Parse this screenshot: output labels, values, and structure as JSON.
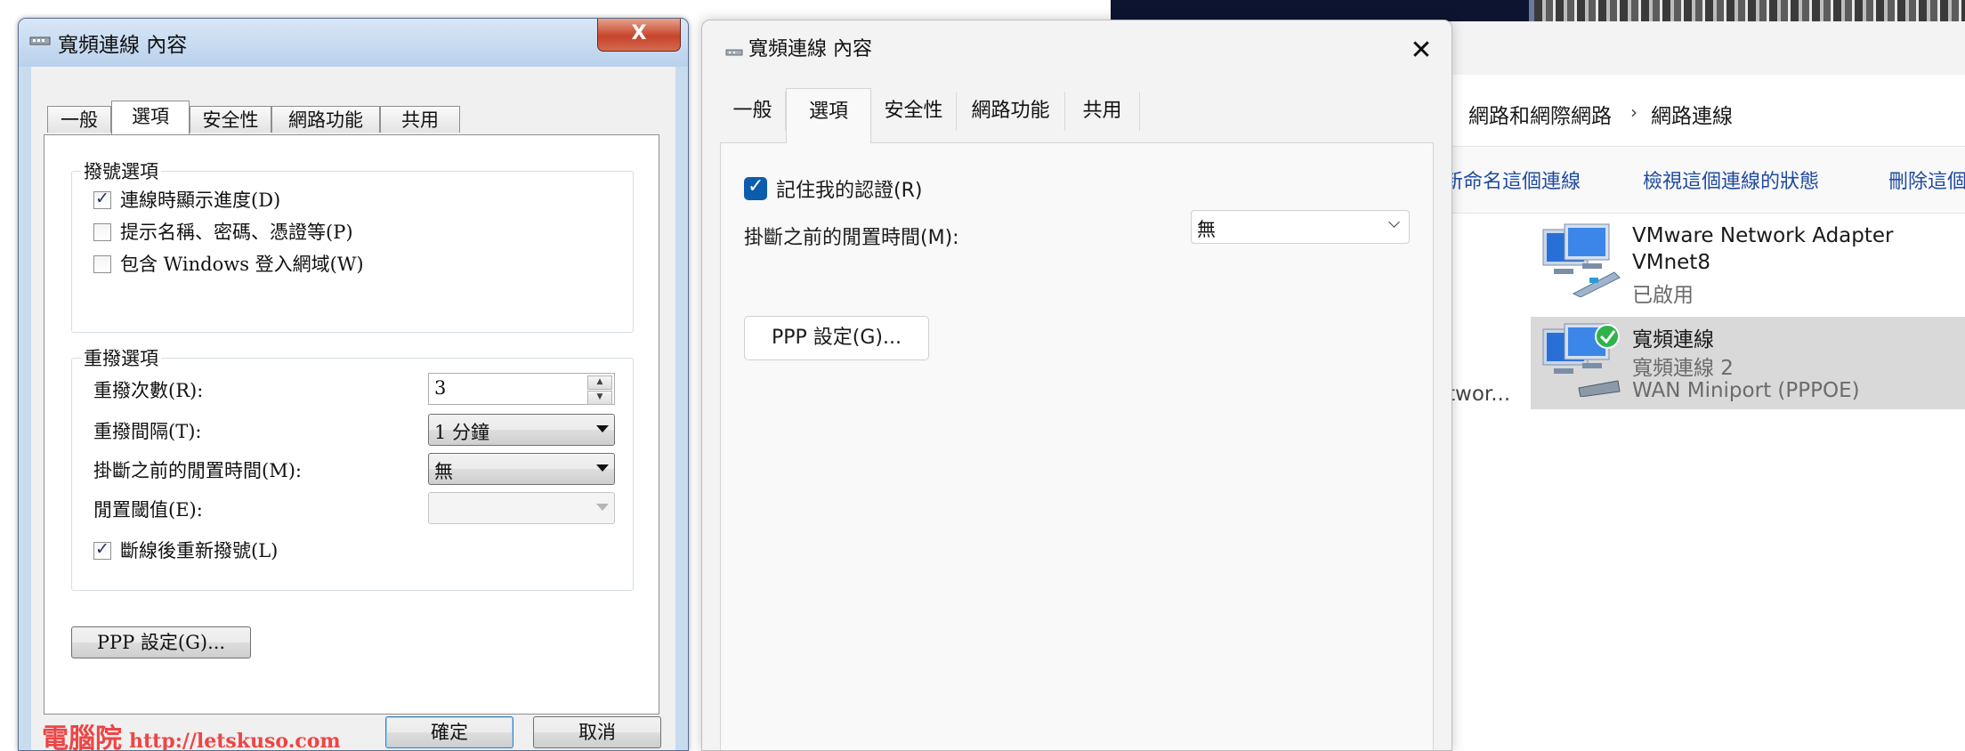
{
  "background_window": {
    "breadcrumb": [
      "網路和網際網路",
      "網路連線"
    ],
    "command_bar": [
      "新命名這個連線",
      "檢視這個連線的狀態",
      "刪除這個"
    ],
    "truncated_item_label": "twor...",
    "connections": [
      {
        "name": "VMware Network Adapter",
        "name_line2": "VMnet8",
        "status": "已啟用",
        "icon": "network-adapter-icon"
      },
      {
        "name": "寬頻連線",
        "status": "寬頻連線 2",
        "device": "WAN Miniport (PPPOE)",
        "icon": "broadband-connected-icon",
        "selected": true
      }
    ]
  },
  "win7_dialog": {
    "title": "寬頻連線 內容",
    "close_glyph": "X",
    "tabs": [
      "一般",
      "選項",
      "安全性",
      "網路功能",
      "共用"
    ],
    "active_tab": "選項",
    "dialing_group": {
      "legend": "撥號選項",
      "options": [
        {
          "label": "連線時顯示進度(D)",
          "checked": true
        },
        {
          "label": "提示名稱、密碼、憑證等(P)",
          "checked": false
        },
        {
          "label": "包含 Windows 登入網域(W)",
          "checked": false
        }
      ]
    },
    "redial_group": {
      "legend": "重撥選項",
      "redial_attempts_label": "重撥次數(R):",
      "redial_attempts_value": "3",
      "redial_interval_label": "重撥間隔(T):",
      "redial_interval_value": "1 分鐘",
      "idle_time_label": "掛斷之前的閒置時間(M):",
      "idle_time_value": "無",
      "idle_threshold_label": "閒置閾值(E):",
      "idle_threshold_value": "",
      "redial_on_drop_label": "斷線後重新撥號(L)",
      "redial_on_drop_checked": true
    },
    "ppp_button": "PPP 設定(G)...",
    "ok_button": "確定",
    "cancel_button": "取消",
    "watermark": {
      "brand": "電腦院",
      "url": "http://letskuso.com"
    }
  },
  "win11_dialog": {
    "title": "寬頻連線 內容",
    "close_glyph": "✕",
    "tabs": [
      "一般",
      "選項",
      "安全性",
      "網路功能",
      "共用"
    ],
    "active_tab": "選項",
    "remember_credentials_label": "記住我的認證(R)",
    "remember_credentials_checked": true,
    "idle_time_label": "掛斷之前的閒置時間(M):",
    "idle_time_value": "無",
    "ppp_button": "PPP 設定(G)..."
  },
  "colors": {
    "win11_accent": "#0b5cad",
    "win7_close": "#c7442b",
    "selection": "#d9d9d9"
  }
}
